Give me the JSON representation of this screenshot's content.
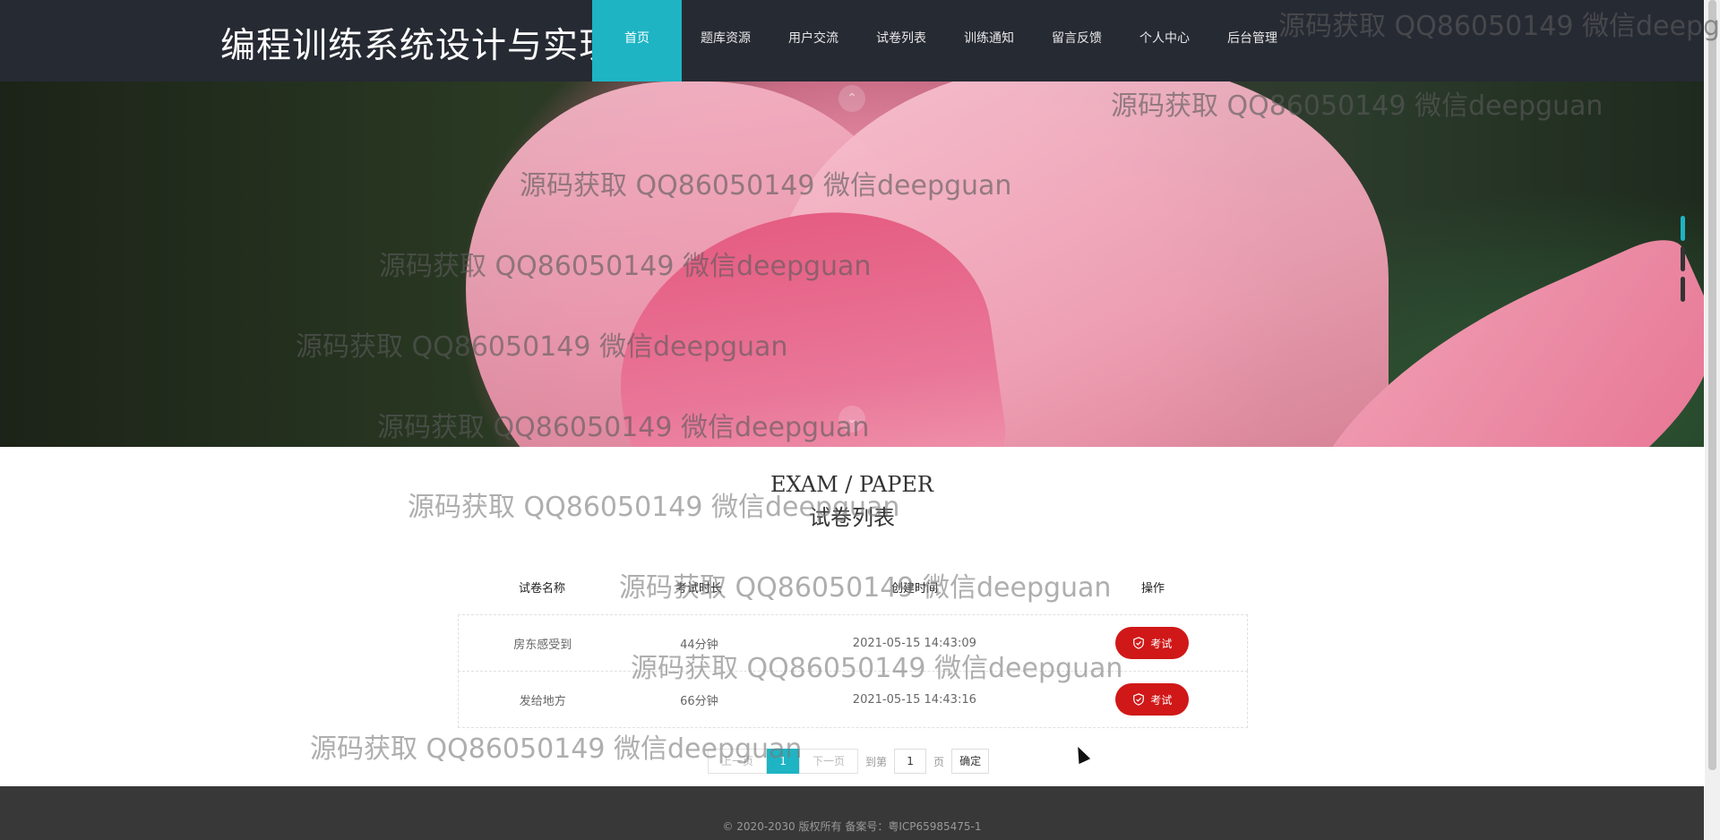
{
  "header": {
    "brand": "编程训练系统设计与实现",
    "nav": [
      {
        "label": "首页",
        "active": true
      },
      {
        "label": "题库资源"
      },
      {
        "label": "用户交流"
      },
      {
        "label": "试卷列表"
      },
      {
        "label": "训练通知"
      },
      {
        "label": "留言反馈"
      },
      {
        "label": "个人中心"
      },
      {
        "label": "后台管理"
      }
    ]
  },
  "section": {
    "title_en": "EXAM / PAPER",
    "title_cn": "试卷列表"
  },
  "table": {
    "headers": [
      "试卷名称",
      "考试时长",
      "创建时间",
      "操作"
    ],
    "rows": [
      {
        "name": "房东感受到",
        "duration": "44分钟",
        "created": "2021-05-15 14:43:09",
        "action": "考试"
      },
      {
        "name": "发给地方",
        "duration": "66分钟",
        "created": "2021-05-15 14:43:16",
        "action": "考试"
      }
    ]
  },
  "pagination": {
    "prev": "上一页",
    "current": "1",
    "next": "下一页",
    "goto_label": "到第",
    "page_input": "1",
    "page_unit": "页",
    "confirm": "确定"
  },
  "footer": {
    "copyright": "© 2020-2030 版权所有 备案号：粤ICP65985475-1"
  },
  "watermark": "源码获取 QQ86050149 微信deepguan",
  "colors": {
    "header_bg": "#262a33",
    "accent": "#1eb4c4",
    "exam_button": "#d01818",
    "footer_bg": "#383838"
  }
}
